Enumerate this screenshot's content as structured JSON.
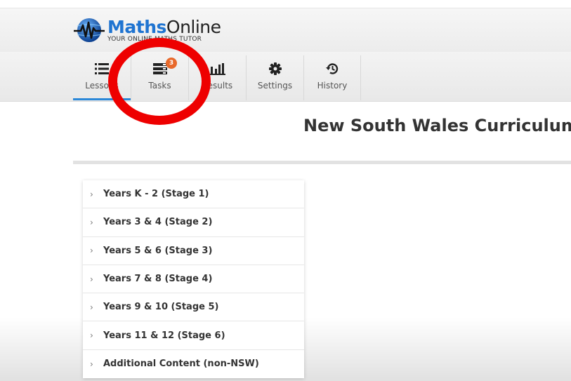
{
  "colors": {
    "accent": "#2b88d8",
    "brand_blue": "#1f74d1",
    "badge": "#e8692b",
    "annotation_red": "#ee0000"
  },
  "header": {
    "brand_part1": "Maths",
    "brand_part2": "Online",
    "tagline": "YOUR ONLINE MATHS TUTOR",
    "logo_icon": "globe-heartbeat-icon"
  },
  "nav": {
    "tabs": [
      {
        "label": "Lessons",
        "icon": "list-icon",
        "active": true
      },
      {
        "label": "Tasks",
        "icon": "tasks-icon",
        "badge": "3"
      },
      {
        "label": "Results",
        "icon": "bar-chart-icon"
      },
      {
        "label": "Settings",
        "icon": "gear-icon"
      },
      {
        "label": "History",
        "icon": "history-icon"
      }
    ]
  },
  "main": {
    "title": "New South Wales Curriculum",
    "curriculum": [
      {
        "label": "Years K - 2 (Stage 1)"
      },
      {
        "label": "Years 3 & 4 (Stage 2)"
      },
      {
        "label": "Years 5 & 6 (Stage 3)"
      },
      {
        "label": "Years 7 & 8 (Stage 4)"
      },
      {
        "label": "Years 9 & 10 (Stage 5)"
      },
      {
        "label": "Years 11 & 12 (Stage 6)"
      },
      {
        "label": "Additional Content (non-NSW)"
      }
    ],
    "chevron": "›"
  }
}
